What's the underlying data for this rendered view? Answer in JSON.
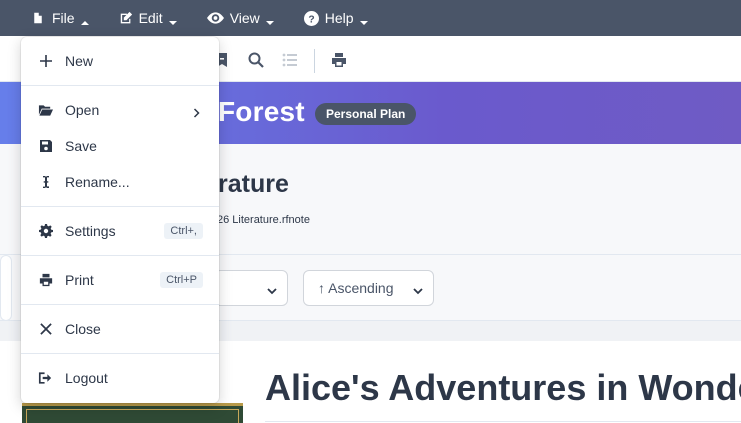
{
  "menubar": {
    "items": [
      {
        "label": "File",
        "icon": "file-icon"
      },
      {
        "label": "Edit",
        "icon": "edit-icon"
      },
      {
        "label": "View",
        "icon": "eye-icon"
      },
      {
        "label": "Help",
        "icon": "help-icon"
      }
    ]
  },
  "banner": {
    "title": "Forest",
    "plan": "Personal Plan"
  },
  "document": {
    "title": "rature",
    "filename": "26 Literature.rfnote"
  },
  "controls": {
    "sort_order": "↑ Ascending"
  },
  "content": {
    "book_title": "Alice's Adventures in Wonde"
  },
  "file_menu": {
    "new": "New",
    "open": "Open",
    "save": "Save",
    "rename": "Rename...",
    "settings": "Settings",
    "settings_shortcut": "Ctrl+,",
    "print": "Print",
    "print_shortcut": "Ctrl+P",
    "close": "Close",
    "logout": "Logout"
  },
  "colors": {
    "menubar": "#4a5568",
    "banner_start": "#667eea",
    "banner_end": "#6f5bc4",
    "badge": "#4a5568"
  }
}
